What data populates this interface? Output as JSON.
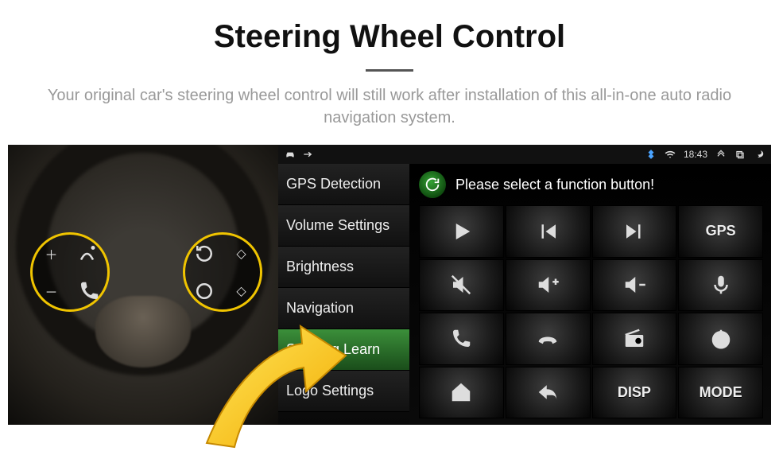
{
  "hero": {
    "title": "Steering Wheel Control",
    "subtitle": "Your original car's steering wheel control will still work after installation of this all-in-one auto radio navigation system."
  },
  "statusbar": {
    "time": "18:43"
  },
  "sidebar": {
    "items": [
      {
        "label": "GPS Detection"
      },
      {
        "label": "Volume Settings"
      },
      {
        "label": "Brightness"
      },
      {
        "label": "Navigation"
      },
      {
        "label": "Steering Learn"
      },
      {
        "label": "Logo Settings"
      }
    ],
    "selected_index": 4
  },
  "panel": {
    "header_text": "Please select a function button!",
    "buttons": [
      {
        "name": "play-icon",
        "kind": "icon"
      },
      {
        "name": "prev-track-icon",
        "kind": "icon"
      },
      {
        "name": "next-track-icon",
        "kind": "icon"
      },
      {
        "name": "gps-text",
        "kind": "text",
        "label": "GPS"
      },
      {
        "name": "mute-icon",
        "kind": "icon"
      },
      {
        "name": "vol-up-icon",
        "kind": "icon"
      },
      {
        "name": "vol-down-icon",
        "kind": "icon"
      },
      {
        "name": "mic-icon",
        "kind": "icon"
      },
      {
        "name": "phone-icon",
        "kind": "icon"
      },
      {
        "name": "hangup-icon",
        "kind": "icon"
      },
      {
        "name": "radio-icon",
        "kind": "icon"
      },
      {
        "name": "power-icon",
        "kind": "icon"
      },
      {
        "name": "home-icon",
        "kind": "icon"
      },
      {
        "name": "back-icon",
        "kind": "icon"
      },
      {
        "name": "disp-text",
        "kind": "text",
        "label": "DISP"
      },
      {
        "name": "mode-text",
        "kind": "text",
        "label": "MODE"
      }
    ]
  },
  "wheel": {
    "left_cluster": [
      "plus",
      "voice",
      "minus",
      "phone"
    ],
    "right_cluster": [
      "rotate",
      "diamond",
      "cycle",
      "diamond"
    ]
  }
}
